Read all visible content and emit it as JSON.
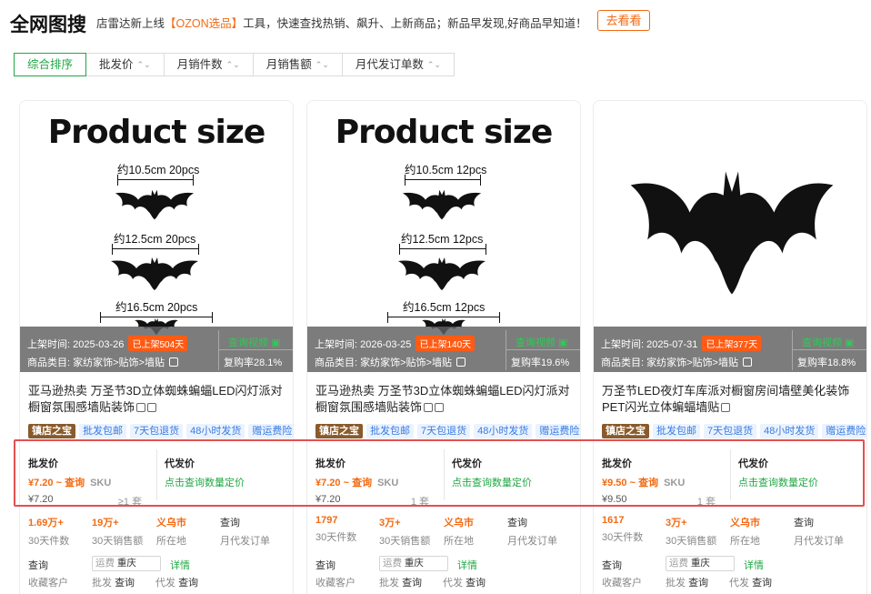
{
  "header": {
    "logo": "全网图搜",
    "promo_prefix": "店雷达新上线",
    "promo_highlight": "【OZON选品】",
    "promo_suffix": "工具，快速查找热销、飙升、上新商品；新品早发现,好商品早知道！",
    "goto_button": "去看看"
  },
  "sort": {
    "items": [
      {
        "label": "综合排序",
        "active": true
      },
      {
        "label": "批发价"
      },
      {
        "label": "月销件数"
      },
      {
        "label": "月销售额"
      },
      {
        "label": "月代发订单数"
      }
    ]
  },
  "common": {
    "list_time_label": "上架时间:",
    "category_label": "商品类目:",
    "video_link": "查询视频",
    "wholesale_label": "批发价",
    "dropship_label": "代发价",
    "dropship_link": "点击查询数量定价",
    "sku": "SKU",
    "query": "查询",
    "fav": "收藏客户",
    "ship_prefix": "运费",
    "detail": "详情",
    "pf": "批发",
    "df": "代发",
    "stat_labels": [
      "30天件数",
      "30天销售额",
      "所在地",
      "月代发订单"
    ],
    "tags": [
      "镇店之宝",
      "批发包邮",
      "7天包退货",
      "48小时发货",
      "赠运费险"
    ]
  },
  "products": [
    {
      "image_title": "Product size",
      "sizes": [
        "约10.5cm  20pcs",
        "约12.5cm  20pcs",
        "约16.5cm  20pcs"
      ],
      "list_date": "2025-03-26",
      "listed_badge": "已上架504天",
      "category": "家纺家饰>贴饰>墙贴",
      "repurchase": "复购率28.1%",
      "title": "亚马逊热卖 万圣节3D立体蜘蛛蝙蝠LED闪灯派对橱窗氛围感墙贴装饰",
      "price_range": "¥7.20 ~ 查询",
      "unit_price": "¥7.20",
      "moq": "≥1 套",
      "stat_values": [
        "1.69万+",
        "19万+",
        "义乌市",
        "查询"
      ],
      "ship_city": "重庆"
    },
    {
      "image_title": "Product size",
      "sizes": [
        "约10.5cm  12pcs",
        "约12.5cm  12pcs",
        "约16.5cm  12pcs"
      ],
      "list_date": "2026-03-25",
      "listed_badge": "已上架140天",
      "category": "家纺家饰>贴饰>墙贴",
      "repurchase": "复购率19.6%",
      "title": "亚马逊热卖 万圣节3D立体蜘蛛蝙蝠LED闪灯派对橱窗氛围感墙贴装饰",
      "price_range": "¥7.20 ~ 查询",
      "unit_price": "¥7.20",
      "moq": "1 套",
      "stat_values": [
        "1797",
        "3万+",
        "义乌市",
        "查询"
      ],
      "ship_city": "重庆"
    },
    {
      "image_title": "",
      "sizes": [],
      "list_date": "2025-07-31",
      "listed_badge": "已上架377天",
      "category": "家纺家饰>贴饰>墙贴",
      "repurchase": "复购率18.8%",
      "title": "万圣节LED夜灯车库派对橱窗房间墙壁美化装饰PET闪光立体蝙蝠墙贴",
      "price_range": "¥9.50 ~ 查询",
      "unit_price": "¥9.50",
      "moq": "1 套",
      "stat_values": [
        "1617",
        "3万+",
        "义乌市",
        "查询"
      ],
      "ship_city": "重庆"
    }
  ],
  "colors": {
    "accent_green": "#22a745",
    "accent_orange": "#f26a13",
    "highlight_red": "#e35050"
  }
}
